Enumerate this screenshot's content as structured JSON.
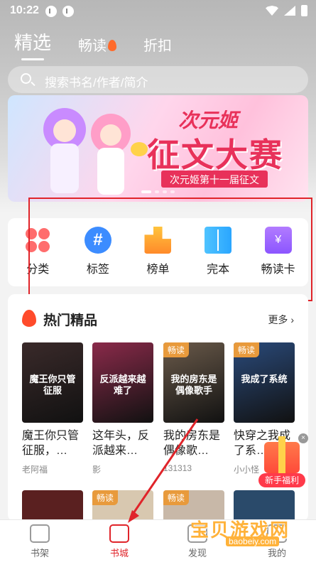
{
  "status": {
    "time": "10:22"
  },
  "tabs": [
    {
      "label": "精选"
    },
    {
      "label": "畅读"
    },
    {
      "label": "折扣"
    }
  ],
  "search": {
    "placeholder": "搜索书名/作者/简介"
  },
  "banner": {
    "title_top": "次元姬",
    "title_main": "征文大赛",
    "subtitle": "次元姬第十一届征文"
  },
  "categories": [
    {
      "label": "分类",
      "icon": "grid-icon"
    },
    {
      "label": "标签",
      "icon": "hashtag-icon"
    },
    {
      "label": "榜单",
      "icon": "podium-icon"
    },
    {
      "label": "完本",
      "icon": "open-book-icon"
    },
    {
      "label": "畅读卡",
      "icon": "yen-card-icon"
    }
  ],
  "hot": {
    "title": "热门精品",
    "more": "更多",
    "books": [
      {
        "name": "魔王你只管征服，…",
        "author": "老阿福",
        "tag": "",
        "cover_text": "魔王你只管征服",
        "color": "#3a2a2a"
      },
      {
        "name": "这年头，反派越来…",
        "author": "影",
        "tag": "",
        "cover_text": "反派越来越难了",
        "color": "#8a2a4a"
      },
      {
        "name": "我的房东是偶像歌…",
        "author": "131313",
        "tag": "畅读",
        "cover_text": "我的房东是偶像歌手",
        "color": "#6a5a4a"
      },
      {
        "name": "快穿之我成了系…",
        "author": "小小怪",
        "tag": "畅读",
        "cover_text": "我成了系统",
        "color": "#2a4a7a"
      }
    ],
    "row2_tags": [
      "",
      "畅读",
      "畅读",
      ""
    ]
  },
  "gift": {
    "label": "新手福利",
    "close": "×"
  },
  "nav": [
    {
      "label": "书架"
    },
    {
      "label": "书城"
    },
    {
      "label": "发现"
    },
    {
      "label": "我的"
    }
  ],
  "watermark": {
    "text": "宝贝游戏网",
    "url": "baobeiy.com"
  },
  "colors": {
    "accent": "#e0242a",
    "banner_red": "#e8315a",
    "tag_orange": "#e89a3c"
  }
}
